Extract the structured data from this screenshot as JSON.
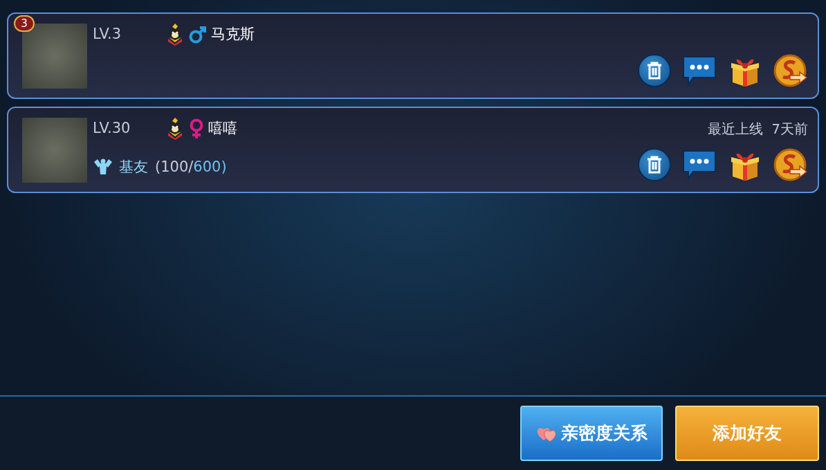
{
  "friends": [
    {
      "rank": "3",
      "level": "LV.3",
      "kind": "male",
      "name": "马克斯"
    },
    {
      "level": "LV.30",
      "kind": "female",
      "name": "嘻嘻",
      "last_online": {
        "label": "最近上线",
        "value": "7天前"
      },
      "intimacy": {
        "label": "基友",
        "current": "(100/",
        "max": "600)"
      }
    }
  ],
  "buttons": [
    {
      "label": "亲密度关系",
      "kind": "blue"
    },
    {
      "label": "添加好友",
      "kind": "gold"
    }
  ]
}
